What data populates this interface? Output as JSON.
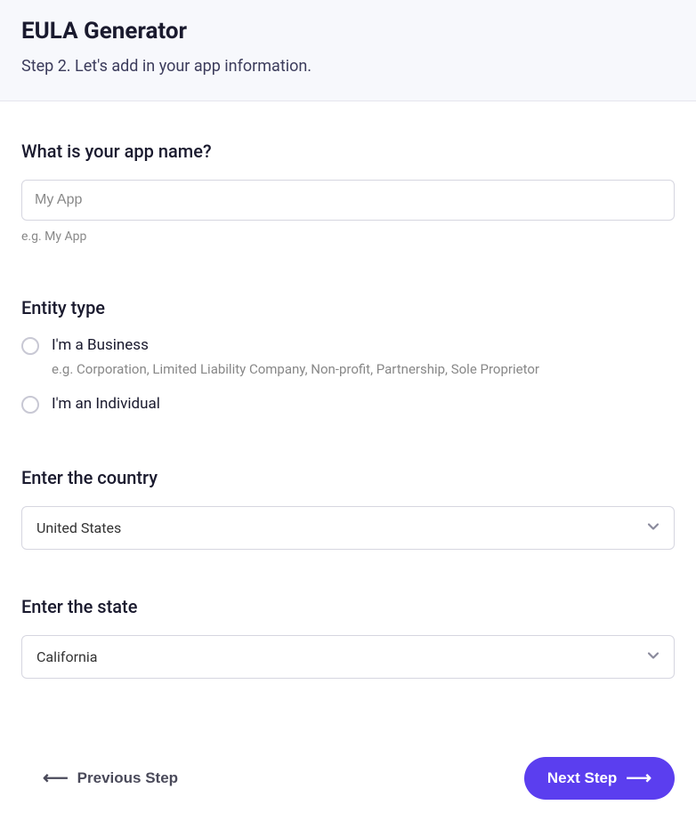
{
  "header": {
    "title": "EULA Generator",
    "subtitle": "Step 2. Let's add in your app information."
  },
  "appName": {
    "label": "What is your app name?",
    "placeholder": "My App",
    "value": "",
    "hint": "e.g. My App"
  },
  "entityType": {
    "label": "Entity type",
    "options": [
      {
        "label": "I'm a Business",
        "hint": "e.g. Corporation, Limited Liability Company, Non-profit, Partnership, Sole Proprietor"
      },
      {
        "label": "I'm an Individual",
        "hint": ""
      }
    ]
  },
  "country": {
    "label": "Enter the country",
    "selected": "United States"
  },
  "state": {
    "label": "Enter the state",
    "selected": "California"
  },
  "footer": {
    "prevLabel": "Previous Step",
    "nextLabel": "Next Step"
  },
  "colors": {
    "accent": "#5b3eef",
    "headerBg": "#f7f8fc",
    "textDark": "#1a1a2e",
    "textMuted": "#888"
  }
}
